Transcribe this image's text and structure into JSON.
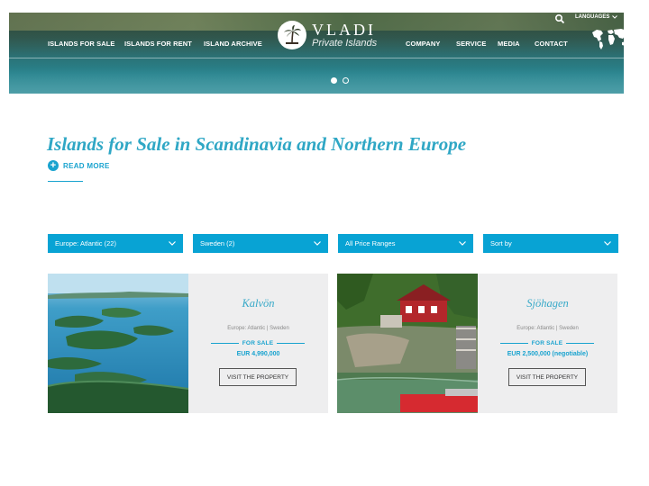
{
  "nav": {
    "left_items": [
      "ISLANDS FOR SALE",
      "ISLANDS FOR RENT",
      "ISLAND ARCHIVE"
    ],
    "right_items": [
      "COMPANY",
      "SERVICE",
      "MEDIA",
      "CONTACT"
    ],
    "languages_label": "LANGUAGES"
  },
  "logo": {
    "title": "VLADI",
    "subtitle": "Private Islands"
  },
  "slider": {
    "slide_count": 2,
    "active_index": 0
  },
  "page": {
    "title": "Islands for Sale in Scandinavia and Northern Europe",
    "read_more_label": "READ MORE"
  },
  "filters": {
    "region": "Europe: Atlantic (22)",
    "country": "Sweden (2)",
    "price": "All Price Ranges",
    "sort": "Sort by"
  },
  "listings": [
    {
      "name": "Kalvön",
      "location": "Europe: Atlantic  |  Sweden",
      "status": "FOR SALE",
      "price": "EUR 4,990,000",
      "button_label": "VISIT THE PROPERTY"
    },
    {
      "name": "Sjöhagen",
      "location": "Europe: Atlantic  |  Sweden",
      "status": "FOR SALE",
      "price": "EUR 2,500,000 (negotiable)",
      "button_label": "VISIT THE PROPERTY"
    }
  ],
  "colors": {
    "accent": "#19a3cf",
    "filter_bg": "#08a3d4",
    "title": "#2fa7c5",
    "card_bg": "#eeeeef"
  }
}
